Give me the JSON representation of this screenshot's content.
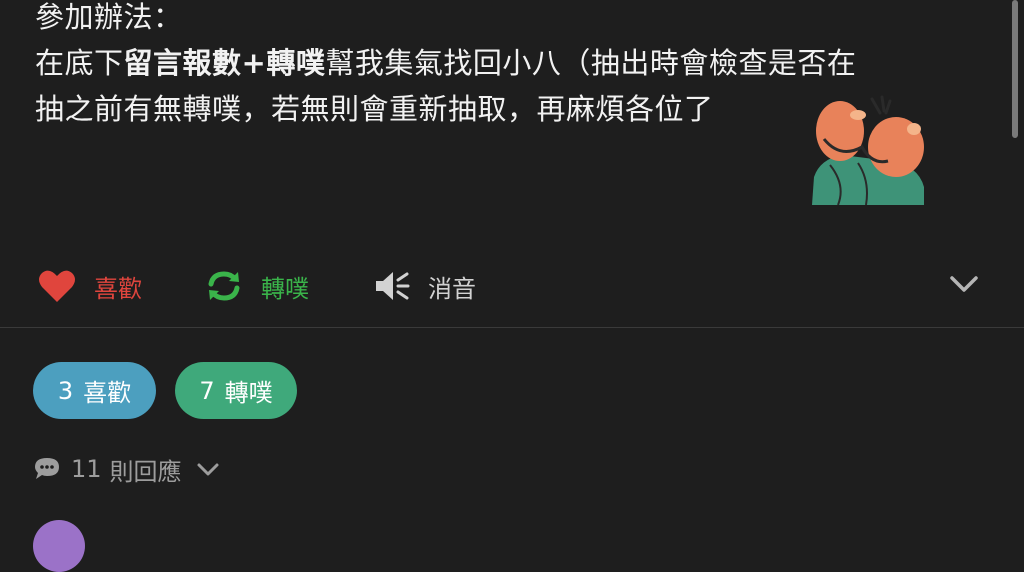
{
  "post": {
    "line1": "參加辦法：",
    "line2_prefix": "在底下",
    "line2_bold_1": "留言報數",
    "line2_bold_2": "+轉噗",
    "line2_rest": "幫我集氣找回小八（抽出時會檢查是否在",
    "line3": "抽之前有無轉噗，若無則會重新抽取，再麻煩各位了"
  },
  "actions": {
    "like_label": "喜歡",
    "replurk_label": "轉噗",
    "mute_label": "消音"
  },
  "stats": {
    "likes_count": "3",
    "likes_label": "喜歡",
    "replurks_count": "7",
    "replurks_label": "轉噗"
  },
  "responses": {
    "count": "11",
    "label": "則回應"
  },
  "colors": {
    "background": "#1e1e1e",
    "like": "#e0453d",
    "replurk": "#3ab44a",
    "likes_pill": "#4c9fbf",
    "replurks_pill": "#3fa97b",
    "muted_text": "#9d9d9d"
  },
  "icons": [
    "heart-icon",
    "replurk-icon",
    "speaker-mute-icon",
    "chevron-down-icon",
    "speech-bubble-icon"
  ]
}
